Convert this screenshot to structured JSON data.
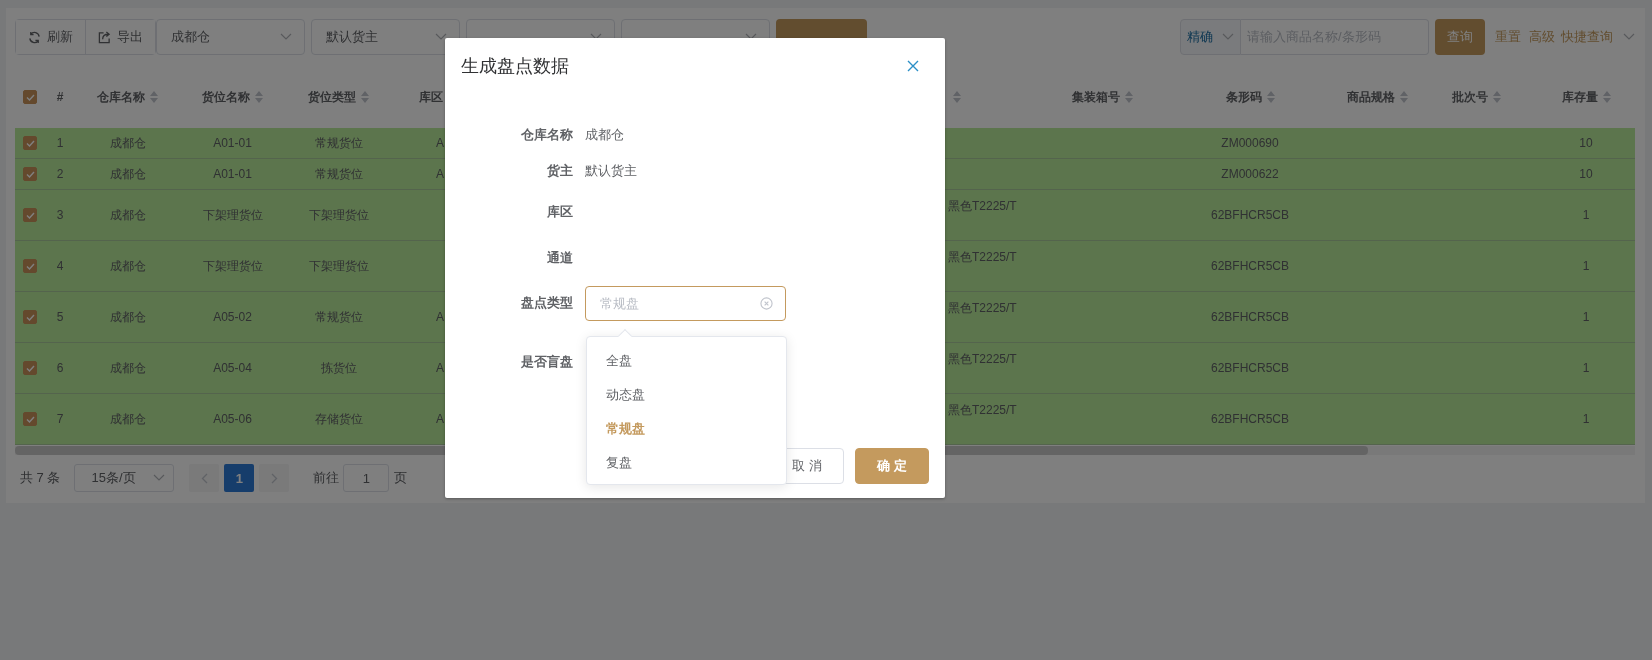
{
  "toolbar": {
    "buttons": [
      {
        "label": "刷新",
        "kind": "refresh"
      },
      {
        "label": "导出",
        "kind": "export"
      }
    ],
    "filters": [
      {
        "kind": "value",
        "value": "成都仓"
      },
      {
        "kind": "value",
        "value": "默认货主"
      },
      {
        "kind": "covered"
      },
      {
        "kind": "covered"
      }
    ],
    "generate_button": true,
    "search": {
      "mode": "精确",
      "placeholder": "请输入商品名称/条形码",
      "button": "查询"
    },
    "links": [
      "重置",
      "高级"
    ],
    "quick_query": {
      "label": "快捷查询"
    }
  },
  "table": {
    "all_selected": true,
    "columns": [
      {
        "label": "#",
        "sortable": false
      },
      {
        "label": "仓库名称",
        "sortable": true
      },
      {
        "label": "货位名称",
        "sortable": true
      },
      {
        "label": "货位类型",
        "sortable": true
      },
      {
        "label": "库区",
        "sortable": false
      },
      {
        "sortable": true
      },
      {
        "label": "集装箱号",
        "sortable": true
      },
      {
        "label": "条形码",
        "sortable": true
      },
      {
        "label": "商品规格",
        "sortable": true
      },
      {
        "label": "批次号",
        "sortable": true
      },
      {
        "label": "库存量",
        "sortable": true
      }
    ],
    "rows": [
      {
        "selected": true,
        "index": "1",
        "warehouse": "成都仓",
        "location": "A01-01",
        "location_type": "常规货位",
        "zone": "A",
        "barcode": "ZM000690",
        "quantity": "10"
      },
      {
        "selected": true,
        "index": "2",
        "warehouse": "成都仓",
        "location": "A01-01",
        "location_type": "常规货位",
        "zone": "A",
        "barcode": "ZM000622",
        "quantity": "10"
      },
      {
        "selected": true,
        "index": "3",
        "warehouse": "成都仓",
        "location": "下架理货位",
        "location_type": "下架理货位",
        "product": "黑色T2225/T",
        "barcode": "62BFHCR5CB",
        "quantity": "1"
      },
      {
        "selected": true,
        "index": "4",
        "warehouse": "成都仓",
        "location": "下架理货位",
        "location_type": "下架理货位",
        "product": "黑色T2225/T",
        "barcode": "62BFHCR5CB",
        "quantity": "1"
      },
      {
        "selected": true,
        "index": "5",
        "warehouse": "成都仓",
        "location": "A05-02",
        "location_type": "常规货位",
        "zone": "A",
        "product": "黑色T2225/T",
        "barcode": "62BFHCR5CB",
        "quantity": "1"
      },
      {
        "selected": true,
        "index": "6",
        "warehouse": "成都仓",
        "location": "A05-04",
        "location_type": "拣货位",
        "zone": "A",
        "product": "黑色T2225/T",
        "barcode": "62BFHCR5CB",
        "quantity": "1"
      },
      {
        "selected": true,
        "index": "7",
        "warehouse": "成都仓",
        "location": "A05-06",
        "location_type": "存储货位",
        "zone": "A",
        "product": "黑色T2225/T",
        "barcode": "62BFHCR5CB",
        "quantity": "1"
      }
    ]
  },
  "pagination": {
    "total": "共 7 条",
    "page_size": "15条/页",
    "pages": [
      {
        "label": "1",
        "selected": true
      }
    ],
    "goto_label": "前往",
    "goto_value": "1",
    "page_suffix": "页"
  },
  "dialog": {
    "title": "生成盘点数据",
    "fields": [
      {
        "label": "仓库名称",
        "kind": "text",
        "value": "成都仓"
      },
      {
        "label": "货主",
        "kind": "text",
        "value": "默认货主"
      },
      {
        "label": "库区",
        "kind": "empty"
      },
      {
        "label": "通道",
        "kind": "empty"
      },
      {
        "label": "盘点类型",
        "kind": "select",
        "placeholder": "常规盘",
        "focused": true,
        "open": true,
        "options": [
          {
            "label": "全盘",
            "selected": false
          },
          {
            "label": "动态盘",
            "selected": false
          },
          {
            "label": "常规盘",
            "selected": true
          },
          {
            "label": "复盘",
            "selected": false
          }
        ]
      },
      {
        "label": "是否盲盘",
        "kind": "empty"
      }
    ],
    "buttons": [
      {
        "label": "取 消",
        "kind": "secondary"
      },
      {
        "label": "确 定",
        "kind": "primary"
      }
    ]
  }
}
